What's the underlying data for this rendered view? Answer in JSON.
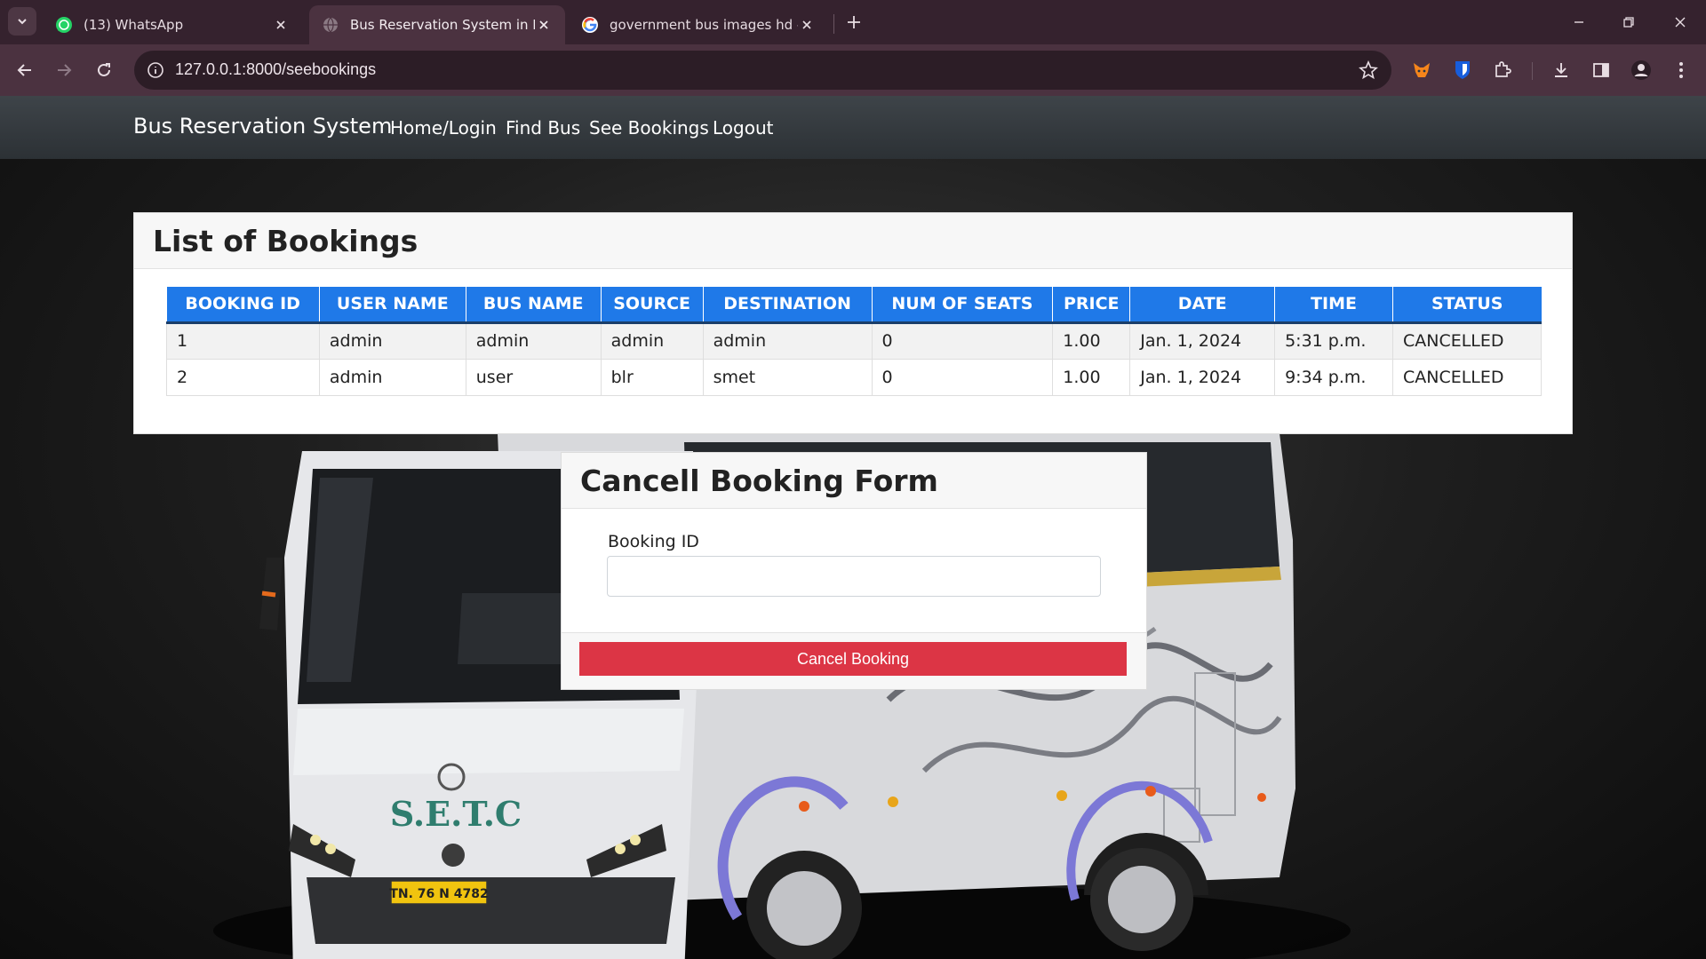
{
  "browser": {
    "tabs": [
      {
        "title": "(13) WhatsApp",
        "icon": "whatsapp-icon",
        "active": false
      },
      {
        "title": "Bus Reservation System in Djang",
        "icon": "globe-icon",
        "active": true
      },
      {
        "title": "government bus images hd - Go",
        "icon": "google-icon",
        "active": false
      }
    ],
    "url": "127.0.0.1:8000/seebookings"
  },
  "navbar": {
    "brand": "Bus Reservation System",
    "links": [
      "Home/Login",
      "Find Bus",
      "See Bookings",
      "Logout"
    ]
  },
  "bookings": {
    "title": "List of Bookings",
    "columns": [
      "BOOKING ID",
      "USER NAME",
      "BUS NAME",
      "SOURCE",
      "DESTINATION",
      "NUM OF SEATS",
      "PRICE",
      "DATE",
      "TIME",
      "STATUS"
    ],
    "rows": [
      [
        "1",
        "admin",
        "admin",
        "admin",
        "admin",
        "0",
        "1.00",
        "Jan. 1, 2024",
        "5:31 p.m.",
        "CANCELLED"
      ],
      [
        "2",
        "admin",
        "user",
        "blr",
        "smet",
        "0",
        "1.00",
        "Jan. 1, 2024",
        "9:34 p.m.",
        "CANCELLED"
      ]
    ]
  },
  "cancel_form": {
    "title": "Cancell Booking Form",
    "field_label": "Booking ID",
    "field_value": "",
    "button_label": "Cancel Booking"
  },
  "bus_image": {
    "plate": "TN. 76 N 4782",
    "logo_text": "S.E.T.C"
  },
  "colors": {
    "table_header": "#1f79e8",
    "danger_button": "#dc3545",
    "navbar": "#343a40",
    "tabstrip": "#35222e"
  }
}
